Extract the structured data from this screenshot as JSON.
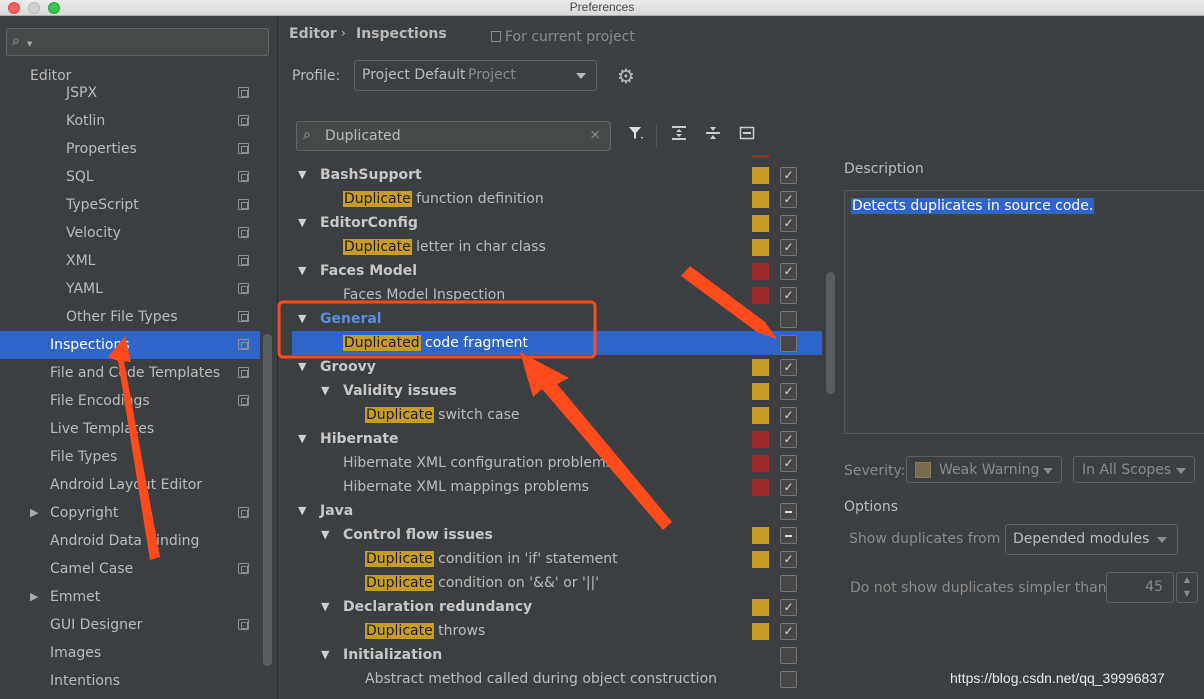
{
  "window": {
    "title": "Preferences"
  },
  "sidebar": {
    "section": "Editor",
    "items": [
      {
        "label": "JSPX",
        "copy": true
      },
      {
        "label": "Kotlin",
        "copy": true
      },
      {
        "label": "Properties",
        "copy": true
      },
      {
        "label": "SQL",
        "copy": true
      },
      {
        "label": "TypeScript",
        "copy": true
      },
      {
        "label": "Velocity",
        "copy": true
      },
      {
        "label": "XML",
        "copy": true
      },
      {
        "label": "YAML",
        "copy": true
      },
      {
        "label": "Other File Types",
        "copy": true
      },
      {
        "label": "Inspections",
        "copy": true,
        "selected": true
      },
      {
        "label": "File and Code Templates",
        "copy": true
      },
      {
        "label": "File Encodings",
        "copy": true
      },
      {
        "label": "Live Templates",
        "copy": false
      },
      {
        "label": "File Types",
        "copy": false
      },
      {
        "label": "Android Layout Editor",
        "copy": false
      },
      {
        "label": "Copyright",
        "copy": true,
        "expandable": true
      },
      {
        "label": "Android Data Binding",
        "copy": false
      },
      {
        "label": "Camel Case",
        "copy": true
      },
      {
        "label": "Emmet",
        "copy": false,
        "expandable": true
      },
      {
        "label": "GUI Designer",
        "copy": true
      },
      {
        "label": "Images",
        "copy": false
      },
      {
        "label": "Intentions",
        "copy": false
      }
    ]
  },
  "header": {
    "crumb1": "Editor",
    "crumb_sep": "›",
    "crumb2": "Inspections",
    "for_project": "For current project",
    "profile_label": "Profile:",
    "profile_value": "Project Default",
    "profile_kind": "Project"
  },
  "filter": {
    "value": "Duplicated",
    "clear": "×"
  },
  "toolbar": {
    "filter_icon": "filter-icon",
    "expand": "expand-all-icon",
    "collapse": "collapse-all-icon",
    "reset": "reset-icon"
  },
  "tree": [
    {
      "level": 0,
      "text": "BashSupport",
      "sev": "warn",
      "check": "on"
    },
    {
      "level": 1,
      "hl": "Duplicate",
      "rest": " function definition",
      "sev": "warn",
      "check": "on"
    },
    {
      "level": 0,
      "text": "EditorConfig",
      "sev": "warn",
      "check": "on"
    },
    {
      "level": 1,
      "hl": "Duplicate",
      "rest": " letter in char class",
      "sev": "warn",
      "check": "on"
    },
    {
      "level": 0,
      "text": "Faces Model",
      "sev": "err",
      "check": "on"
    },
    {
      "level": 1,
      "text": "Faces Model Inspection",
      "sev": "err",
      "check": "on"
    },
    {
      "level": 0,
      "text": "General",
      "blue": true,
      "check": "off"
    },
    {
      "level": 1,
      "hl": "Duplicated",
      "rest": " code fragment",
      "selected": true,
      "check": "off"
    },
    {
      "level": 0,
      "text": "Groovy",
      "sev": "warn",
      "check": "on"
    },
    {
      "level": 1,
      "text": "Validity issues",
      "group": true,
      "sev": "warn",
      "check": "on"
    },
    {
      "level": 2,
      "hl": "Duplicate",
      "rest": " switch case",
      "sev": "warn",
      "check": "on"
    },
    {
      "level": 0,
      "text": "Hibernate",
      "sev": "err",
      "check": "on"
    },
    {
      "level": 1,
      "text": "Hibernate XML configuration problems",
      "sev": "err",
      "check": "on"
    },
    {
      "level": 1,
      "text": "Hibernate XML mappings problems",
      "sev": "err",
      "check": "on"
    },
    {
      "level": 0,
      "text": "Java",
      "check": "mixed"
    },
    {
      "level": 1,
      "text": "Control flow issues",
      "group": true,
      "sev": "warn",
      "check": "mixed"
    },
    {
      "level": 2,
      "hl": "Duplicate",
      "rest": " condition in 'if' statement",
      "sev": "warn",
      "check": "on"
    },
    {
      "level": 2,
      "hl": "Duplicate",
      "rest": " condition on '&&' or '||'",
      "check": "off"
    },
    {
      "level": 1,
      "text": "Declaration redundancy",
      "group": true,
      "sev": "warn",
      "check": "on"
    },
    {
      "level": 2,
      "hl": "Duplicate",
      "rest": " throws",
      "sev": "warn",
      "check": "on"
    },
    {
      "level": 1,
      "text": "Initialization",
      "group": true,
      "check": "off"
    },
    {
      "level": 2,
      "text": "Abstract method called during object construction",
      "check": "off"
    }
  ],
  "details": {
    "description_label": "Description",
    "description_text": "Detects duplicates in source code.",
    "severity_label": "Severity:",
    "severity_value": "Weak Warning",
    "scope_value": "In All Scopes",
    "options_label": "Options",
    "show_dup_label": "Show duplicates from",
    "show_dup_value": "Depended modules",
    "simpler_label": "Do not show duplicates simpler than:",
    "simpler_value": "45"
  },
  "watermark": "https://blog.csdn.net/qq_39996837",
  "colors": {
    "accent": "#2f65ca",
    "warning": "#c89d26",
    "error": "#9b2a2a",
    "annotation": "#ff4a1c"
  }
}
